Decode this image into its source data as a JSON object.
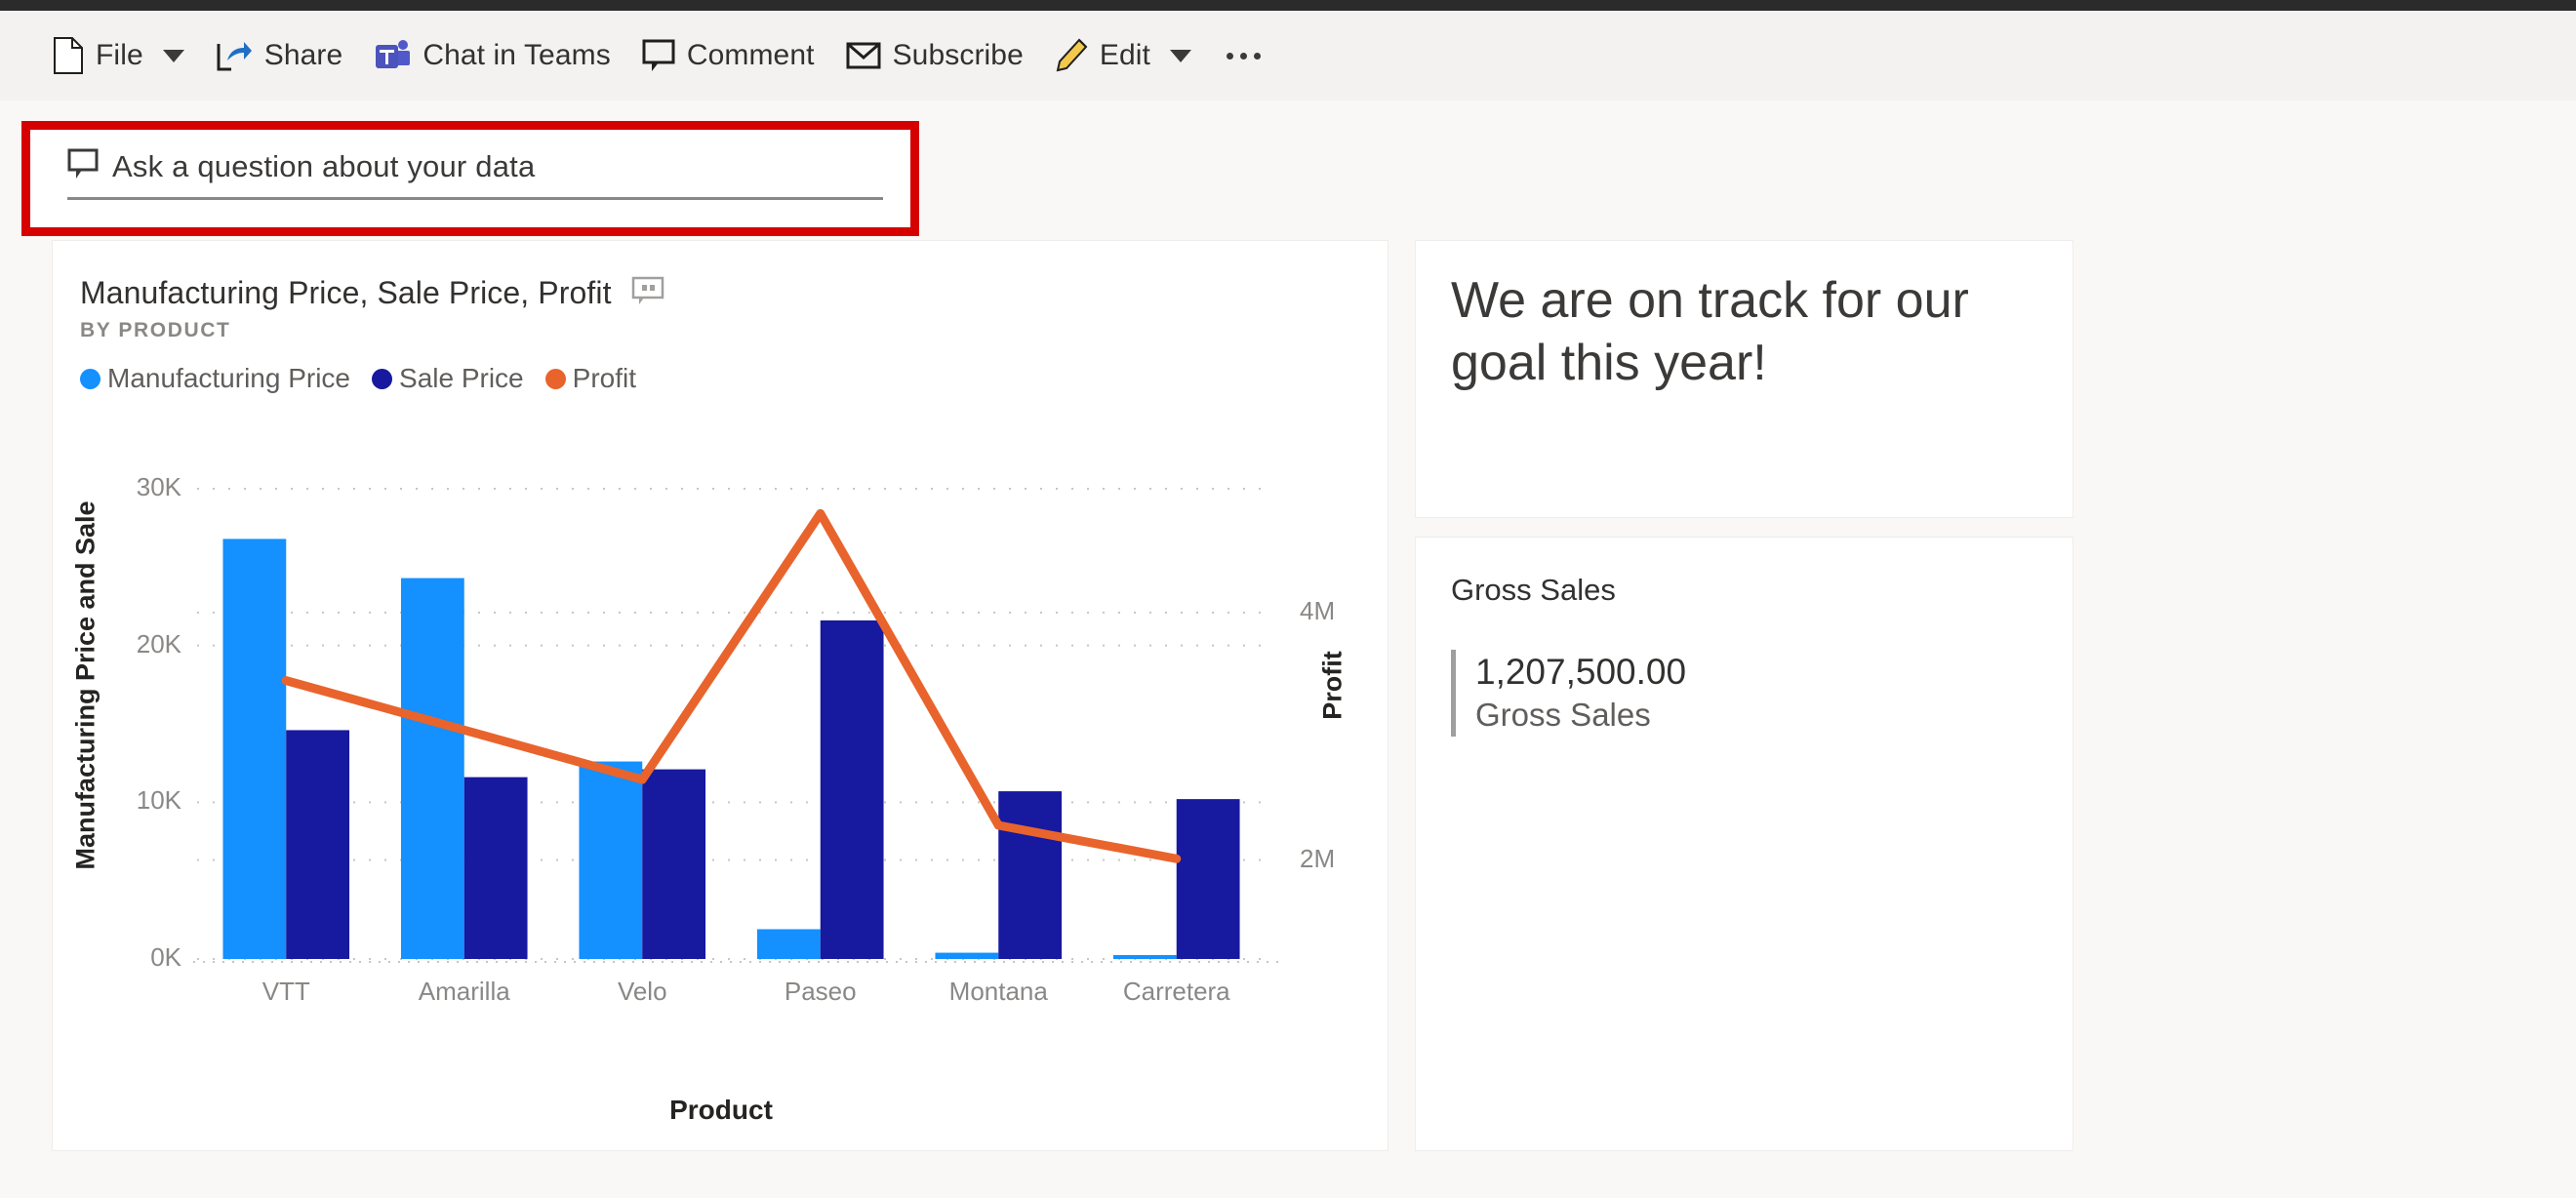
{
  "command_bar": {
    "items": [
      {
        "label": "File",
        "icon": "file-icon",
        "has_chevron": true
      },
      {
        "label": "Share",
        "icon": "share-icon",
        "has_chevron": false
      },
      {
        "label": "Chat in Teams",
        "icon": "teams-icon",
        "has_chevron": false
      },
      {
        "label": "Comment",
        "icon": "comment-icon",
        "has_chevron": false
      },
      {
        "label": "Subscribe",
        "icon": "subscribe-icon",
        "has_chevron": false
      },
      {
        "label": "Edit",
        "icon": "edit-icon",
        "has_chevron": true
      }
    ],
    "overflow_label": "More options"
  },
  "qa_bar": {
    "placeholder": "Ask a question about your data",
    "value": "",
    "icon": "qa-comment-icon",
    "highlight_color": "#d60000"
  },
  "chart_tile": {
    "title": "Manufacturing Price, Sale Price, Profit",
    "subtitle": "BY PRODUCT",
    "comment_icon": "tile-comment-icon"
  },
  "text_tile": {
    "text": "We are on track for our goal this year!"
  },
  "kpi_tile": {
    "title": "Gross Sales",
    "value": "1,207,500.00",
    "caption": "Gross Sales"
  },
  "chart_data": {
    "type": "bar",
    "title": "Manufacturing Price, Sale Price, Profit",
    "subtitle": "BY PRODUCT",
    "xlabel": "Product",
    "ylabel": "Manufacturing Price and Sale",
    "ylabel_secondary": "Profit",
    "categories": [
      "VTT",
      "Amarilla",
      "Velo",
      "Paseo",
      "Montana",
      "Carretera"
    ],
    "ylim": [
      0,
      30000
    ],
    "yticks": [
      0,
      10000,
      20000,
      30000
    ],
    "ytick_labels": [
      "0K",
      "10K",
      "20K",
      "30K"
    ],
    "ylim_secondary": [
      1200000,
      5000000
    ],
    "yticks_secondary": [
      2000000,
      4000000
    ],
    "ytick_labels_secondary": [
      "2M",
      "4M"
    ],
    "grid": true,
    "legend_position": "top-left",
    "series": [
      {
        "name": "Manufacturing Price",
        "type": "bar",
        "color": "#1490ff",
        "axis": "left",
        "values": [
          26800,
          24300,
          12600,
          1900,
          400,
          250
        ]
      },
      {
        "name": "Sale Price",
        "type": "bar",
        "color": "#17199e",
        "axis": "left",
        "values": [
          14600,
          11600,
          12100,
          21600,
          10700,
          10200
        ]
      },
      {
        "name": "Profit",
        "type": "line",
        "color": "#e8642c",
        "axis": "right",
        "values": [
          3450000,
          3050000,
          2650000,
          4800000,
          2280000,
          2010000
        ]
      }
    ]
  }
}
